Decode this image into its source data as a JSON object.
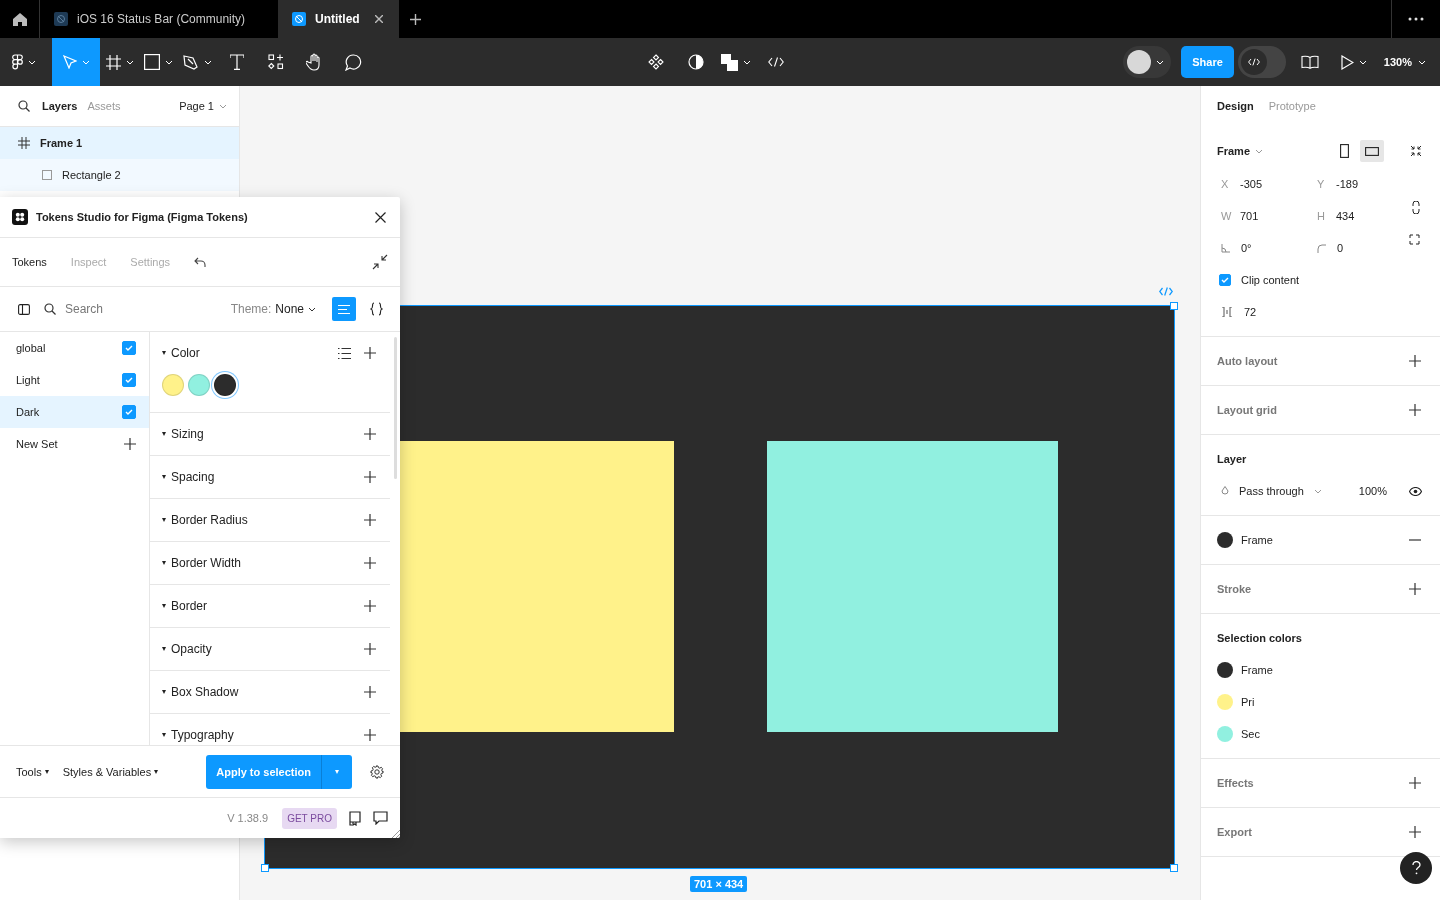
{
  "browser_tabs": [
    {
      "title": "iOS 16 Status Bar (Community)",
      "selected": false
    },
    {
      "title": "Untitled",
      "selected": true
    }
  ],
  "toolbar": {
    "share": "Share",
    "dev_mode": false,
    "zoom": "130%"
  },
  "layers_panel": {
    "tabs": [
      {
        "label": "Layers",
        "selected": true
      },
      {
        "label": "Assets",
        "selected": false
      }
    ],
    "page": "Page 1",
    "layers": [
      {
        "name": "Frame 1",
        "kind": "frame",
        "selected": true,
        "children": [
          {
            "name": "Rectangle 2",
            "kind": "rectangle",
            "selected": false
          }
        ]
      }
    ]
  },
  "canvas": {
    "shapes": [
      {
        "kind": "rectangle",
        "color": "#fff28a"
      },
      {
        "kind": "rectangle",
        "color": "#91f0e0"
      }
    ],
    "size_label": "701 × 434"
  },
  "plugin": {
    "title": "Tokens Studio for Figma (Figma Tokens)",
    "tabs": [
      {
        "label": "Tokens",
        "selected": true
      },
      {
        "label": "Inspect",
        "selected": false
      },
      {
        "label": "Settings",
        "selected": false
      }
    ],
    "search": {
      "placeholder": "Search"
    },
    "theme_label": "Theme:",
    "theme_value": "None",
    "view_modes": [
      {
        "kind": "list",
        "selected": true
      },
      {
        "kind": "json",
        "selected": false
      }
    ],
    "token_sets": [
      {
        "name": "global",
        "checked": true,
        "selected": false
      },
      {
        "name": "Light",
        "checked": true,
        "selected": false
      },
      {
        "name": "Dark",
        "checked": true,
        "selected": true
      }
    ],
    "new_set": "New Set",
    "token_groups": [
      {
        "name": "Color",
        "tokens": [
          {
            "color": "#fff28a",
            "selected": false
          },
          {
            "color": "#91f0e0",
            "selected": false
          },
          {
            "color": "#2c2c2c",
            "selected": true
          }
        ]
      },
      {
        "name": "Sizing"
      },
      {
        "name": "Spacing"
      },
      {
        "name": "Border Radius"
      },
      {
        "name": "Border Width"
      },
      {
        "name": "Border"
      },
      {
        "name": "Opacity"
      },
      {
        "name": "Box Shadow"
      },
      {
        "name": "Typography"
      }
    ],
    "tools_menu": "Tools",
    "styles_menu": "Styles & Variables",
    "apply_button": "Apply to selection",
    "version": "V 1.38.9",
    "pro_badge": "GET PRO"
  },
  "design_panel": {
    "tabs": [
      {
        "label": "Design",
        "selected": true
      },
      {
        "label": "Prototype",
        "selected": false
      }
    ],
    "section_title": "Frame",
    "orientations": [
      {
        "kind": "portrait",
        "selected": false
      },
      {
        "kind": "landscape",
        "selected": true
      }
    ],
    "fields": [
      {
        "label": "X",
        "value": "-305"
      },
      {
        "label": "Y",
        "value": "-189"
      },
      {
        "label": "W",
        "value": "701"
      },
      {
        "label": "H",
        "value": "434"
      }
    ],
    "rotation": "0°",
    "radius": "0",
    "clip_content": {
      "label": "Clip content",
      "checked": true
    },
    "spacing": "72",
    "sections": [
      {
        "kind": "add",
        "title": "Auto layout"
      },
      {
        "kind": "add",
        "title": "Layout grid"
      },
      {
        "kind": "layer",
        "title": "Layer",
        "blend": "Pass through",
        "opacity": "100%"
      },
      {
        "kind": "fill",
        "fills": [
          {
            "name": "Frame",
            "color": "#2c2c2c"
          }
        ]
      },
      {
        "kind": "add",
        "title": "Stroke"
      },
      {
        "kind": "colors",
        "title": "Selection colors",
        "items": [
          {
            "name": "Frame",
            "color": "#2c2c2c"
          },
          {
            "name": "Pri",
            "color": "#fff28a"
          },
          {
            "name": "Sec",
            "color": "#91f0e0"
          }
        ]
      },
      {
        "kind": "add",
        "title": "Effects"
      },
      {
        "kind": "add",
        "title": "Export"
      }
    ]
  }
}
